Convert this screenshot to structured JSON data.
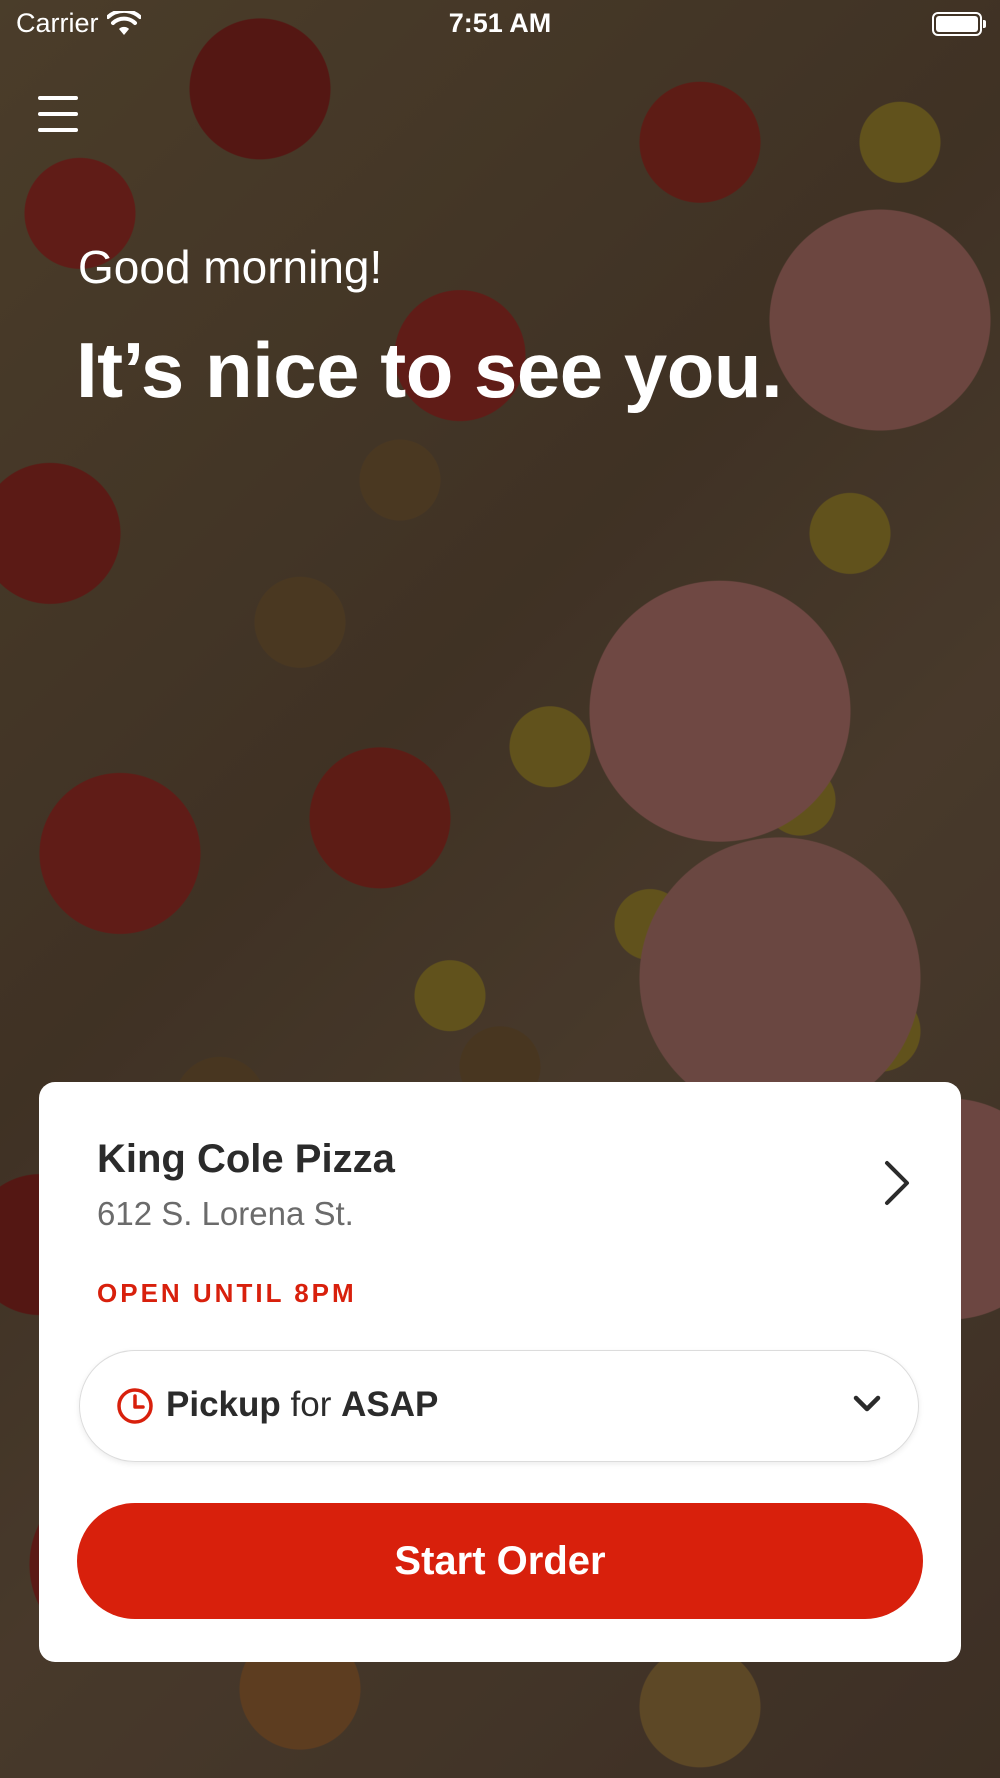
{
  "status_bar": {
    "carrier": "Carrier",
    "time": "7:51 AM"
  },
  "greeting": {
    "small": "Good morning!",
    "large": "It’s nice to see you."
  },
  "store": {
    "name": "King Cole Pizza",
    "address": "612 S. Lorena St.",
    "open_status": "OPEN UNTIL 8PM"
  },
  "order_mode": {
    "mode": "Pickup",
    "connector": "for",
    "time": "ASAP"
  },
  "start_order_label": "Start Order",
  "colors": {
    "accent": "#d8200c",
    "card": "#ffffff",
    "text_dark": "#2b2b2b",
    "text_muted": "#6b6b6b"
  },
  "icons": {
    "menu": "hamburger-menu-icon",
    "wifi": "wifi-icon",
    "battery": "battery-icon",
    "store_chevron": "chevron-right-icon",
    "clock": "clock-icon",
    "dropdown": "chevron-down-icon"
  }
}
